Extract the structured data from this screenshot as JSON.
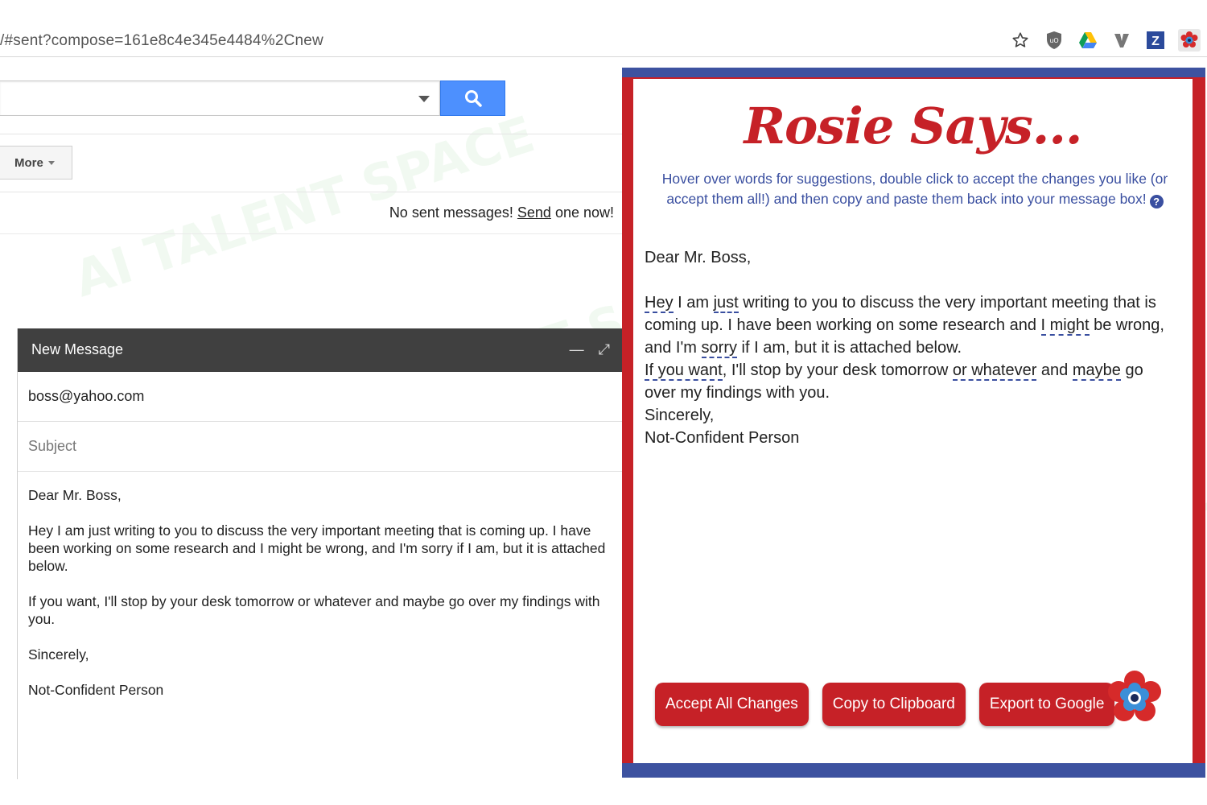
{
  "browser": {
    "url": "/#sent?compose=161e8c4e345e4484%2Cnew",
    "extensions": [
      "star-icon",
      "ublock-shield-icon",
      "google-drive-icon",
      "vimium-v-icon",
      "zotero-z-icon",
      "rosie-flower-icon"
    ]
  },
  "gmail": {
    "more_label": "More",
    "no_sent_prefix": "No sent messages! ",
    "no_sent_link": "Send",
    "no_sent_suffix": " one now!"
  },
  "compose": {
    "title": "New Message",
    "to": "boss@yahoo.com",
    "subject_placeholder": "Subject",
    "body": {
      "greeting": "Dear Mr. Boss,",
      "p1": "Hey I am just writing to you to discuss the very important meeting that is coming up. I have been working on some research and I might be wrong, and I'm sorry if I am, but it is attached below.",
      "p2": "If you want, I'll stop by your desk tomorrow or whatever and maybe go over my findings with you.",
      "closing": "Sincerely,",
      "signature": "Not-Confident Person"
    }
  },
  "rosie": {
    "logo": "Rosie Says...",
    "hint": "Hover over words for suggestions, double click to accept the changes you like (or accept them all!) and then copy and paste them back into your message box!",
    "text": {
      "greeting": "Dear Mr. Boss,",
      "l1_a": "Hey",
      "l1_b": " I am ",
      "l1_c": "just",
      "l1_d": " writing to you to discuss the very important meeting that is coming up. I have been working on some research and ",
      "l1_e": "I might",
      "l1_f": " be wrong, and I'm ",
      "l1_g": "sorry",
      "l1_h": " if I am, but it is attached below.",
      "l2_a": "If you want",
      "l2_b": ", I'll stop by your desk tomorrow ",
      "l2_c": "or whatever",
      "l2_d": " and ",
      "l2_e": "maybe",
      "l2_f": " go over my findings with you.",
      "closing": "Sincerely,",
      "signature": "Not-Confident Person"
    },
    "buttons": {
      "accept": "Accept All Changes",
      "copy": "Copy to Clipboard",
      "export": "Export to Google"
    },
    "colors": {
      "red": "#c62127",
      "blue": "#3d52a0"
    }
  },
  "watermark": "AI TALENT SPACE"
}
